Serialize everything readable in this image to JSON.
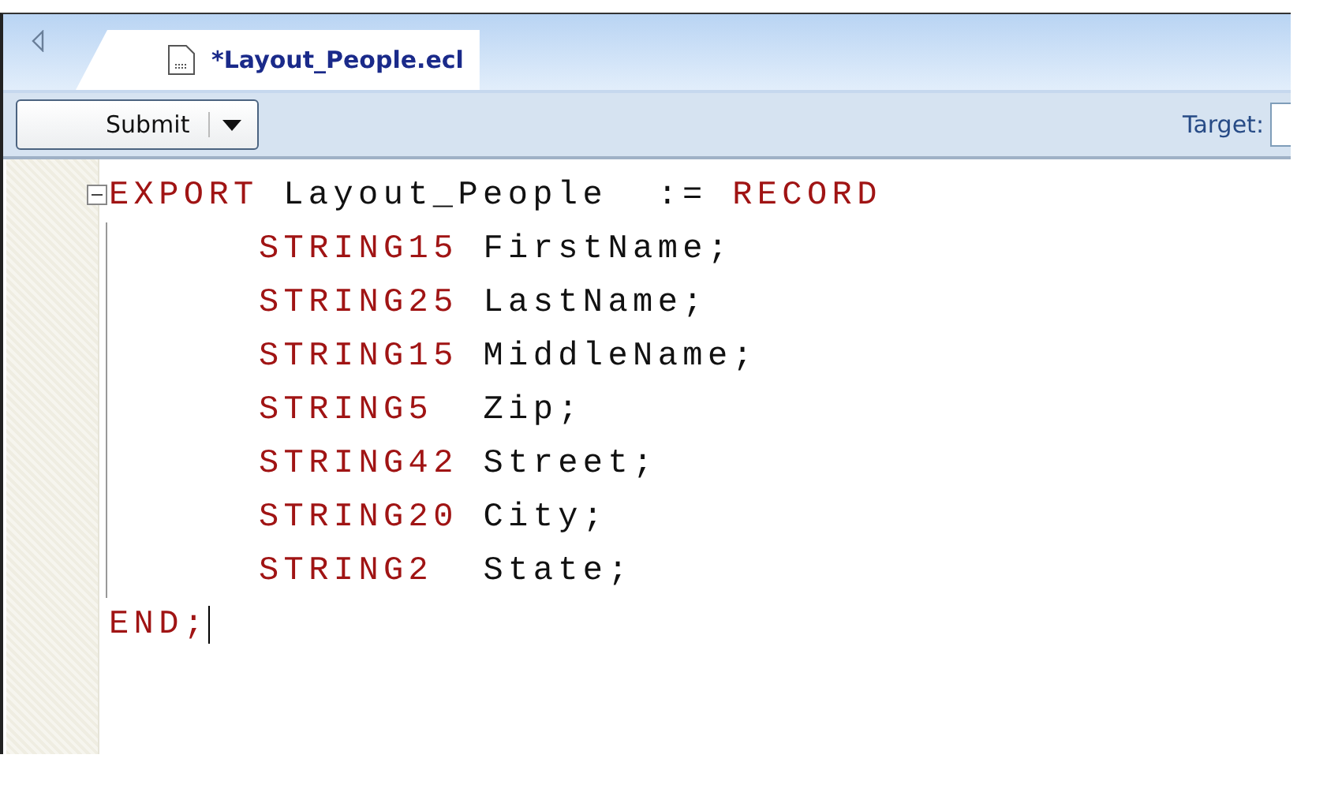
{
  "tabs": [
    {
      "label": "*Layout_People.ecl",
      "selected": true
    }
  ],
  "toolbar": {
    "submit_button": "Submit",
    "target_label": "Target:"
  },
  "editor": {
    "lines": [
      {
        "tokens": [
          {
            "kind": "keyword",
            "text": "EXPORT"
          },
          {
            "kind": "plain",
            "text": " Layout_People  := "
          },
          {
            "kind": "keyword",
            "text": "RECORD"
          }
        ],
        "expanded": true,
        "children": [
          {
            "tokens": [
              {
                "kind": "keyword",
                "text": "STRING15"
              },
              {
                "kind": "plain",
                "text": " FirstName;"
              }
            ]
          },
          {
            "tokens": [
              {
                "kind": "keyword",
                "text": "STRING25"
              },
              {
                "kind": "plain",
                "text": " LastName;"
              }
            ]
          },
          {
            "tokens": [
              {
                "kind": "keyword",
                "text": "STRING15"
              },
              {
                "kind": "plain",
                "text": " MiddleName;"
              }
            ]
          },
          {
            "tokens": [
              {
                "kind": "keyword",
                "text": "STRING5"
              },
              {
                "kind": "plain",
                "text": "  Zip;"
              }
            ]
          },
          {
            "tokens": [
              {
                "kind": "keyword",
                "text": "STRING42"
              },
              {
                "kind": "plain",
                "text": " Street;"
              }
            ]
          },
          {
            "tokens": [
              {
                "kind": "keyword",
                "text": "STRING20"
              },
              {
                "kind": "plain",
                "text": " City;"
              }
            ]
          },
          {
            "tokens": [
              {
                "kind": "keyword",
                "text": "STRING2"
              },
              {
                "kind": "plain",
                "text": "  State;"
              }
            ]
          }
        ]
      },
      {
        "tokens": [
          {
            "kind": "keyword",
            "text": "END;"
          }
        ],
        "cursor": true
      }
    ]
  }
}
